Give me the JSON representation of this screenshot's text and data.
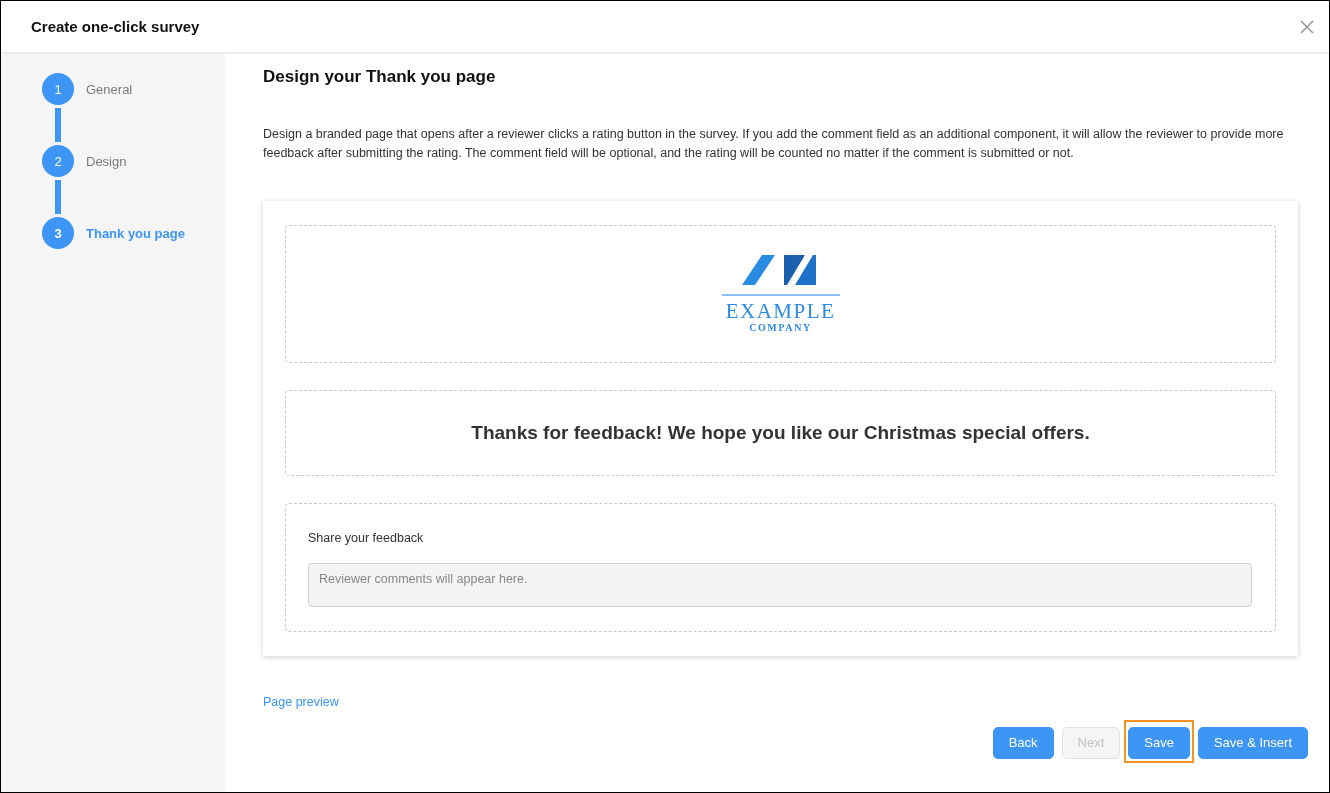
{
  "dialog": {
    "title": "Create one-click survey"
  },
  "steps": [
    {
      "number": "1",
      "label": "General",
      "selected": false
    },
    {
      "number": "2",
      "label": "Design",
      "selected": false
    },
    {
      "number": "3",
      "label": "Thank you page",
      "selected": true
    }
  ],
  "page": {
    "heading": "Design your Thank you page",
    "description": "Design a branded page that opens after a reviewer clicks a rating button in the survey. If you add the comment field as an additional component, it will allow the reviewer to provide more feedback after submitting the rating. The comment field will be optional, and the rating will be counted no matter if the comment is submitted or not."
  },
  "preview": {
    "logo": {
      "name": "EXAMPLE",
      "tagline": "COMPANY"
    },
    "message": "Thanks for feedback! We hope you like our Christmas special offers.",
    "comment": {
      "label": "Share your feedback",
      "placeholder": "Reviewer comments will appear here."
    }
  },
  "preview_link": "Page preview",
  "buttons": [
    {
      "label": "Back",
      "disabled": false,
      "focused": false
    },
    {
      "label": "Next",
      "disabled": true,
      "focused": false
    },
    {
      "label": "Save",
      "disabled": false,
      "focused": true
    },
    {
      "label": "Save & Insert",
      "disabled": false,
      "focused": false
    }
  ]
}
